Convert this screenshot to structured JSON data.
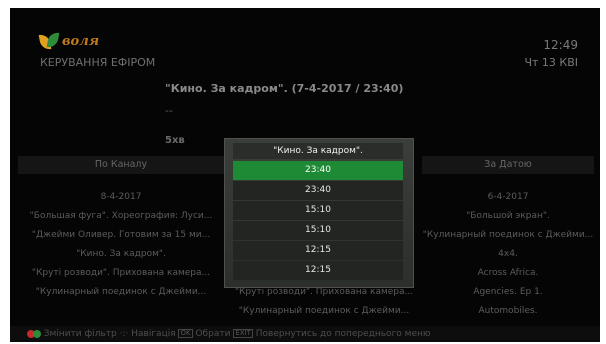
{
  "header": {
    "logo_text": "воля",
    "subtitle": "КЕРУВАННЯ ЕФІРОМ",
    "time": "12:49",
    "date": "Чт 13 КВІ"
  },
  "program": {
    "title": "\"Кино. За кадром\".   (7-4-2017 / 23:40)",
    "description": "--",
    "duration": "5хв"
  },
  "columns": {
    "left_header": "По Каналу",
    "right_header": "За Датою"
  },
  "left_list": [
    "8-4-2017",
    "\"Большая фуга\". Хореография: Луси...",
    "\"Джейми Оливер. Готовим за 15 ми...",
    "\"Кино. За кадром\".",
    "\"Круті розводи\". Прихована камера...",
    "\"Кулинарный поединок с Джейми..."
  ],
  "mid_list": [
    "\"Круті розводи\". Прихована камера...",
    "\"Кулинарный поединок с Джейми..."
  ],
  "right_list": [
    "6-4-2017",
    "\"Большой экран\".",
    "\"Кулинарный поединок с Джейми...",
    "4x4.",
    "Across Africa.",
    "Agencies. Ep 1.",
    "Automobiles."
  ],
  "popup": {
    "title": "\"Кино. За кадром\".",
    "options": [
      "23:40",
      "23:40",
      "15:10",
      "15:10",
      "12:15",
      "12:15"
    ],
    "selected_index": 0
  },
  "footer": {
    "filter_label": "Змінити фільтр",
    "nav_label": "Навігація",
    "ok_key": "OK",
    "select_label": "Обрати",
    "back_key": "EXIT",
    "back_label": "Повернутись до попереднього меню"
  },
  "colors": {
    "accent_green": "#1e8a35",
    "red_key": "#c62a2a",
    "green_key": "#2e8b3a"
  }
}
